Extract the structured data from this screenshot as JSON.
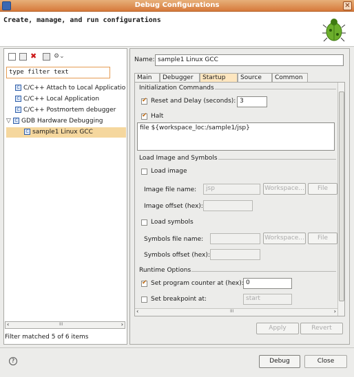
{
  "window": {
    "title": "Debug Configurations"
  },
  "header": {
    "description": "Create, manage, and run configurations"
  },
  "left": {
    "filter_placeholder": "type filter text",
    "tree": [
      {
        "label": "C/C++ Attach to Local Applicatio",
        "type": "config-type"
      },
      {
        "label": "C/C++ Local Application",
        "type": "config-type"
      },
      {
        "label": "C/C++ Postmortem debugger",
        "type": "config-type"
      },
      {
        "label": "GDB Hardware Debugging",
        "type": "config-type",
        "expanded": true
      },
      {
        "label": "sample1 Linux GCC",
        "type": "config",
        "selected": true
      }
    ],
    "scroll_mid": "III",
    "status": "Filter matched 5 of 6 items"
  },
  "right": {
    "name_label": "Name:",
    "name_value": "sample1 Linux GCC",
    "tabs": [
      "Main",
      "Debugger",
      "Startup",
      "Source",
      "Common"
    ],
    "active_tab": "Startup",
    "init": {
      "group": "Initialization Commands",
      "reset_label": "Reset and Delay (seconds):",
      "reset_checked": true,
      "reset_value": "3",
      "halt_label": "Halt",
      "halt_checked": true,
      "commands": "file ${workspace_loc:/sample1/jsp}"
    },
    "load": {
      "group": "Load Image and Symbols",
      "load_image_label": "Load image",
      "load_image_checked": false,
      "image_file_label": "Image file name:",
      "image_file_value": "jsp",
      "workspace_btn": "Workspace...",
      "filesystem_btn": "File Syste",
      "image_offset_label": "Image offset (hex):",
      "load_symbols_label": "Load symbols",
      "load_symbols_checked": false,
      "symbols_file_label": "Symbols file name:",
      "symbols_offset_label": "Symbols offset (hex):"
    },
    "runtime": {
      "group": "Runtime Options",
      "pc_label": "Set program counter at (hex):",
      "pc_checked": true,
      "pc_value": "0",
      "bp_label": "Set breakpoint at:",
      "bp_checked": false,
      "bp_value": "start"
    },
    "scroll_mid": "III",
    "apply_btn": "Apply",
    "revert_btn": "Revert"
  },
  "footer": {
    "debug_btn": "Debug",
    "close_btn": "Close"
  }
}
